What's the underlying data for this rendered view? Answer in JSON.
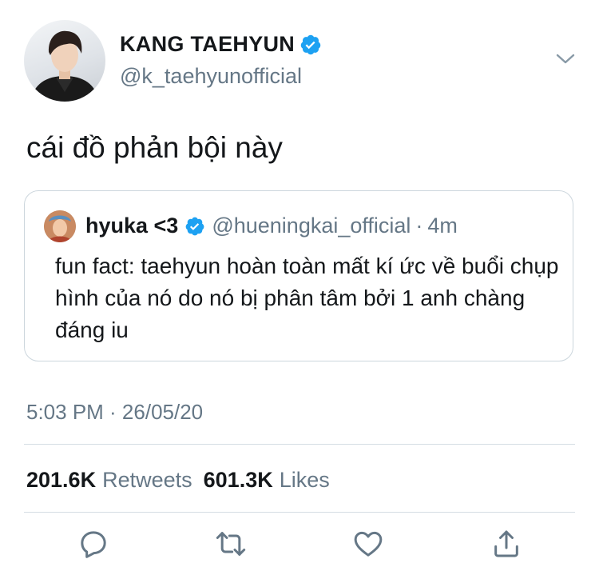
{
  "tweet": {
    "author_name": "KANG TAEHYUN",
    "author_handle": "@k_taehyunofficial",
    "text": "cái đồ phản bội này",
    "timestamp": "5:03 PM · 26/05/20"
  },
  "quoted": {
    "author_name": "hyuka <3",
    "author_handle": "@hueningkai_official",
    "separator": "·",
    "time": "4m",
    "text": "fun fact: taehyun hoàn toàn mất kí ức về buổi chụp hình của nó do nó bị phân tâm bởi 1 anh chàng đáng iu"
  },
  "stats": {
    "retweets_count": "201.6K",
    "retweets_label": "Retweets",
    "likes_count": "601.3K",
    "likes_label": "Likes"
  },
  "icons": {
    "verified": "verified-badge-icon",
    "more": "chevron-down-icon",
    "reply": "reply-icon",
    "retweet": "retweet-icon",
    "like": "heart-icon",
    "share": "share-icon"
  },
  "colors": {
    "verified_blue": "#1da1f2",
    "secondary_text": "#657786",
    "divider": "#d5dde3"
  }
}
